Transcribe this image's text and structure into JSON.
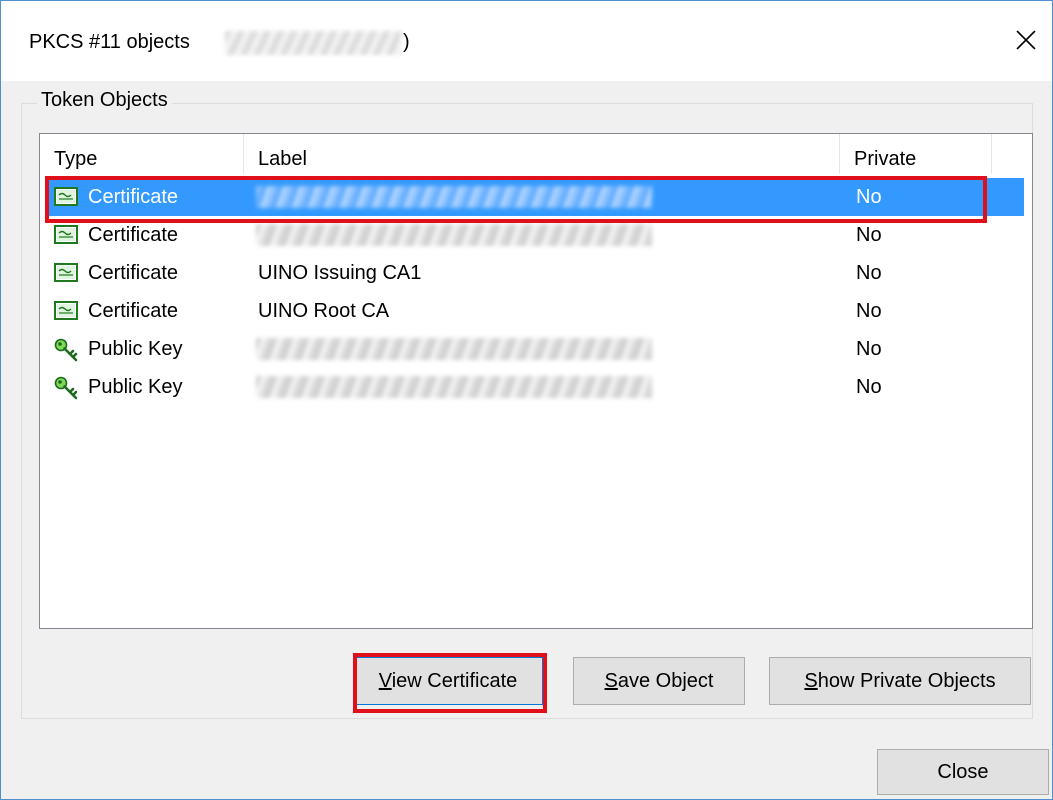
{
  "window": {
    "title": "PKCS #11 objects",
    "title_suffix": ")",
    "close_icon": "close-icon"
  },
  "group": {
    "legend": "Token Objects"
  },
  "table": {
    "columns": [
      "Type",
      "Label",
      "Private"
    ],
    "rows": [
      {
        "type": "Certificate",
        "label": "",
        "private": "No",
        "icon": "certificate-icon",
        "selected": true
      },
      {
        "type": "Certificate",
        "label": "",
        "private": "No",
        "icon": "certificate-icon",
        "selected": false
      },
      {
        "type": "Certificate",
        "label": "UINO Issuing CA1",
        "private": "No",
        "icon": "certificate-icon",
        "selected": false
      },
      {
        "type": "Certificate",
        "label": "UINO Root CA",
        "private": "No",
        "icon": "certificate-icon",
        "selected": false
      },
      {
        "type": "Public Key",
        "label": "",
        "private": "No",
        "icon": "key-icon",
        "selected": false
      },
      {
        "type": "Public Key",
        "label": "",
        "private": "No",
        "icon": "key-icon",
        "selected": false
      }
    ]
  },
  "buttons": {
    "view_certificate": {
      "access_key": "V",
      "rest": "iew Certificate"
    },
    "save_object": {
      "access_key": "S",
      "rest": "ave Object"
    },
    "show_private_objects": {
      "access_key": "S",
      "rest": "how Private Objects"
    },
    "close": "Close"
  },
  "colors": {
    "selection": "#3399ff",
    "highlight": "#e0101a",
    "accent": "#0078d7"
  }
}
